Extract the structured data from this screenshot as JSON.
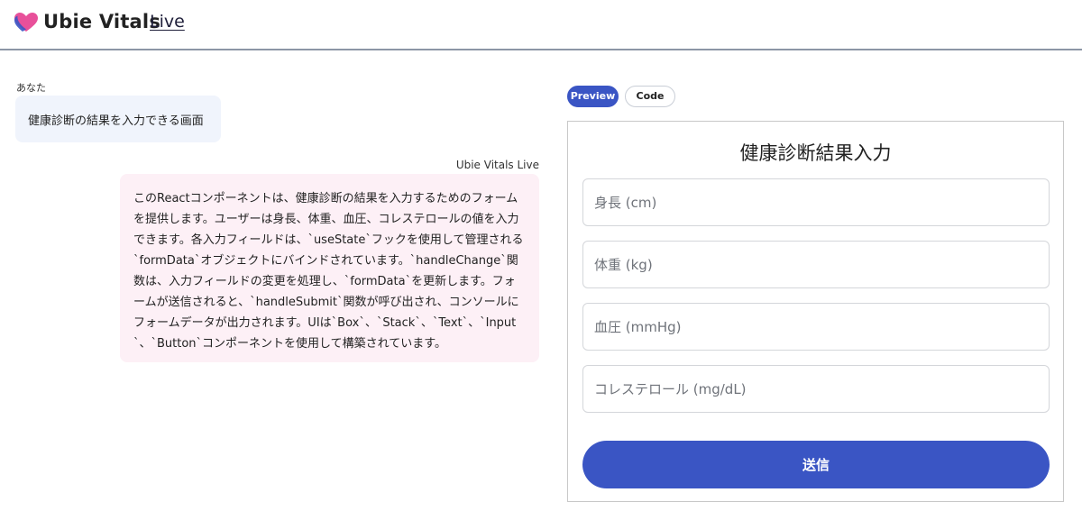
{
  "header": {
    "brand": "Ubie Vitals",
    "live_link": "Live",
    "logo_icon": "heart-logo-icon",
    "logo_colors": [
      "#e8509a",
      "#3a55c4"
    ]
  },
  "chat": {
    "user": {
      "label": "あなた",
      "message": "健康診断の結果を入力できる画面"
    },
    "assistant": {
      "label": "Ubie Vitals Live",
      "message": "このReactコンポーネントは、健康診断の結果を入力するためのフォームを提供します。ユーザーは身長、体重、血圧、コレステロールの値を入力できます。各入力フィールドは、`useState`フックを使用して管理される`formData`オブジェクトにバインドされています。`handleChange`関数は、入力フィールドの変更を処理し、`formData`を更新します。フォームが送信されると、`handleSubmit`関数が呼び出され、コンソールにフォームデータが出力されます。UIは`Box`、`Stack`、`Text`、`Input`、`Button`コンポーネントを使用して構築されています。"
    }
  },
  "tabs": [
    {
      "label": "Preview",
      "active": true
    },
    {
      "label": "Code",
      "active": false
    }
  ],
  "preview": {
    "title": "健康診断結果入力",
    "fields": [
      {
        "placeholder": "身長 (cm)",
        "value": ""
      },
      {
        "placeholder": "体重 (kg)",
        "value": ""
      },
      {
        "placeholder": "血圧 (mmHg)",
        "value": ""
      },
      {
        "placeholder": "コレステロール (mg/dL)",
        "value": ""
      }
    ],
    "submit_label": "送信"
  },
  "colors": {
    "accent": "#3a55c4",
    "user_bubble": "#f0f4fc",
    "assistant_bubble": "#fdf0f6",
    "header_border": "#8c96a6"
  }
}
